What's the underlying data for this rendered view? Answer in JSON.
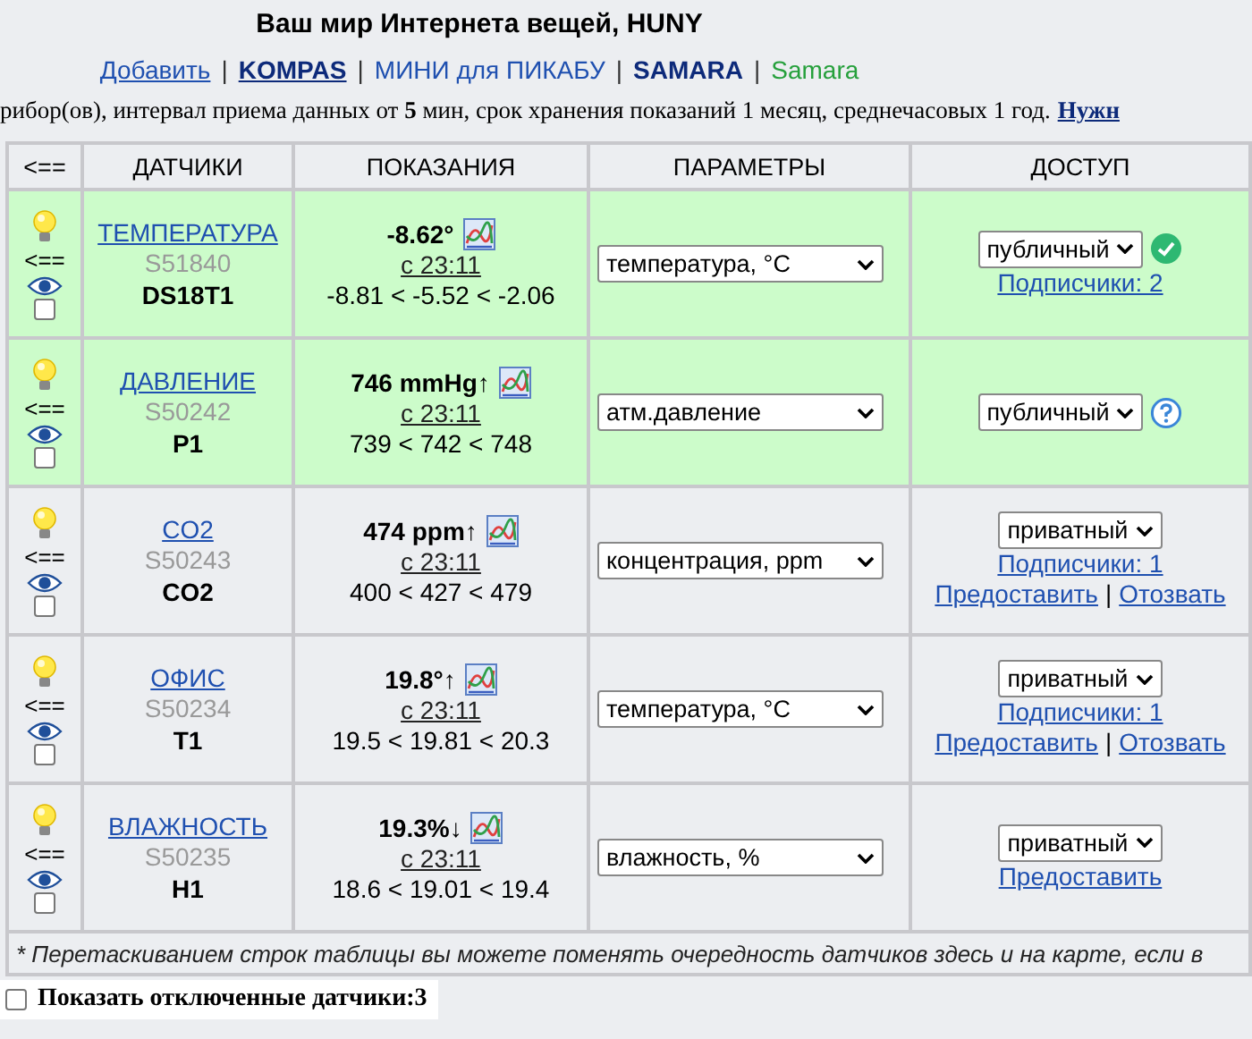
{
  "title": "Ваш мир Интернета вещей, HUNY",
  "nav": [
    {
      "label": "Добавить",
      "kind": "link"
    },
    {
      "label": "KOMPAS",
      "kind": "bold-link"
    },
    {
      "label": "МИНИ для ПИКАБУ",
      "kind": "plain"
    },
    {
      "label": "SAMARA",
      "kind": "bold"
    },
    {
      "label": "Samara",
      "kind": "green"
    }
  ],
  "nav_separator": "|",
  "info": {
    "text": "рибор(ов), интервал приема данных от **5** мин, срок хранения показаний 1 месяц, среднечасовых 1 год.",
    "link": "Нужн"
  },
  "table": {
    "columns": [
      "<==",
      "ДАТЧИКИ",
      "ПОКАЗАНИЯ",
      "ПАРАМЕТРЫ",
      "ДОСТУП"
    ],
    "rows": [
      {
        "kind": "verified",
        "public": true,
        "move": "<==",
        "checked": false,
        "name": "ТЕМПЕРАТУРА",
        "serial": "S51840",
        "type": "DS18T1",
        "value": "-8.62°",
        "since": "с 23:11",
        "range": "-8.81 < -5.52 < -2.06",
        "parameter": "температура, °C",
        "access": "публичный",
        "subscribers": "Подписчики: 2"
      },
      {
        "kind": "help",
        "public": true,
        "move": "<==",
        "checked": false,
        "name": "ДАВЛЕНИЕ",
        "serial": "S50242",
        "type": "P1",
        "value": "746 mmHg↑",
        "since": "с 23:11",
        "range": "739 < 742 < 748",
        "parameter": "атм.давление",
        "access": "публичный"
      },
      {
        "kind": "plain",
        "public": false,
        "move": "<==",
        "checked": false,
        "name": "CO2",
        "serial": "S50243",
        "type": "CO2",
        "value": "474 ppm↑",
        "since": "с 23:11",
        "range": "400 < 427 < 479",
        "parameter": "концентрация, ppm",
        "access": "приватный",
        "subscribers": "Подписчики: 1",
        "grant": "Предоставить",
        "revoke": "Отозвать"
      },
      {
        "kind": "plain",
        "public": false,
        "move": "<==",
        "checked": false,
        "name": "ОФИС",
        "serial": "S50234",
        "type": "T1",
        "value": "19.8°↑",
        "since": "с 23:11",
        "range": "19.5 < 19.81 < 20.3",
        "parameter": "температура, °C",
        "access": "приватный",
        "subscribers": "Подписчики: 1",
        "grant": "Предоставить",
        "revoke": "Отозвать"
      },
      {
        "kind": "plain",
        "public": false,
        "move": "<==",
        "checked": false,
        "name": "ВЛАЖНОСТЬ",
        "serial": "S50235",
        "type": "H1",
        "value": "19.3%↓",
        "since": "с 23:11",
        "range": "18.6 < 19.01 < 19.4",
        "parameter": "влажность, %",
        "access": "приватный",
        "grant": "Предоставить"
      }
    ],
    "footnote": "* Перетаскиванием строк таблицы вы можете поменять очередность датчиков здесь и на карте, если в"
  },
  "show_disabled": {
    "label": "Показать отключенные датчики:3",
    "checked": false
  }
}
